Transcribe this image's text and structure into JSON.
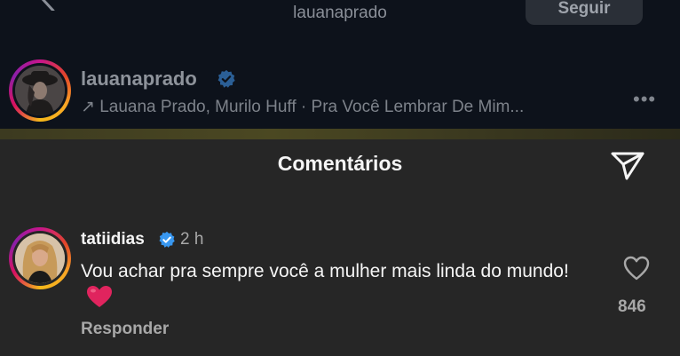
{
  "header": {
    "username": "lauanaprado",
    "follow_label": "Seguir"
  },
  "post": {
    "username": "lauanaprado",
    "verified": true,
    "audio": "↗ Lauana Prado, Murilo Huff · Pra Você Lembrar De Mim..."
  },
  "sheet": {
    "title": "Comentários"
  },
  "comment": {
    "username": "tatiidias",
    "verified": true,
    "time": "2 h",
    "text": "Vou achar pra sempre você a mulher mais linda do mundo!",
    "emoji": "red-heart",
    "reply_label": "Responder",
    "likes": "846"
  },
  "colors": {
    "verified": "#3897f0",
    "heart": "#e0245e"
  }
}
